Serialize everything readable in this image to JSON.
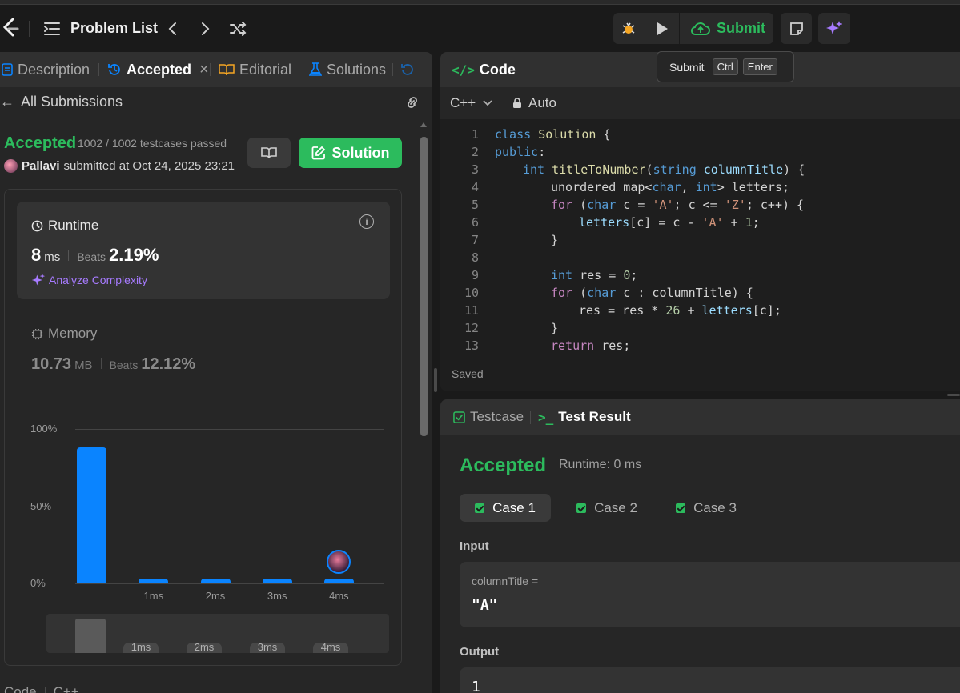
{
  "topbar": {
    "problem_list": "Problem List",
    "submit_label": "Submit"
  },
  "tooltip": {
    "label": "Submit",
    "key1": "Ctrl",
    "key2": "Enter"
  },
  "left_tabs": {
    "description": "Description",
    "accepted": "Accepted",
    "editorial": "Editorial",
    "solutions": "Solutions"
  },
  "submission": {
    "back_label": "All Submissions",
    "status": "Accepted",
    "testcases": "1002 / 1002 testcases passed",
    "user": "Pallavi",
    "submitted_text": "submitted at Oct 24, 2025 23:21",
    "solution_button": "Solution"
  },
  "runtime": {
    "title": "Runtime",
    "value": "8",
    "unit": "ms",
    "beats_label": "Beats",
    "beats_value": "2.19%",
    "analyze": "Analyze Complexity"
  },
  "memory": {
    "title": "Memory",
    "value": "10.73",
    "unit": "MB",
    "beats_label": "Beats",
    "beats_value": "12.12%"
  },
  "chart_data": {
    "type": "bar",
    "categories": [
      "",
      "1ms",
      "2ms",
      "3ms",
      "4ms"
    ],
    "values": [
      88,
      2,
      2,
      2,
      2
    ],
    "ylim": [
      0,
      100
    ],
    "y_ticks": [
      "100%",
      "50%",
      "0%"
    ],
    "minimap_ticks": [
      "1ms",
      "2ms",
      "3ms",
      "4ms"
    ],
    "bar_color": "#0a84ff"
  },
  "bottom_tabs": {
    "code": "Code",
    "lang": "C++"
  },
  "code_panel": {
    "title": "Code",
    "language": "C++",
    "mode": "Auto",
    "saved": "Saved",
    "lines": [
      {
        "n": "1"
      },
      {
        "n": "2"
      },
      {
        "n": "3"
      },
      {
        "n": "4"
      },
      {
        "n": "5"
      },
      {
        "n": "6"
      },
      {
        "n": "7"
      },
      {
        "n": "8"
      },
      {
        "n": "9"
      },
      {
        "n": "10"
      },
      {
        "n": "11"
      },
      {
        "n": "12"
      },
      {
        "n": "13"
      }
    ],
    "tokens": {
      "l1": [
        "class",
        "Solution",
        "{"
      ],
      "l2": [
        "public",
        ":"
      ],
      "l3": [
        "int",
        "titleToNumber",
        "(",
        "string",
        "columnTitle",
        ") {"
      ],
      "l4": [
        "unordered_map<",
        "char",
        ", ",
        "int",
        "> letters;"
      ],
      "l5": [
        "for",
        " (",
        "char",
        " c = ",
        "'A'",
        "; c <= ",
        "'Z'",
        "; c++) {"
      ],
      "l6": [
        "letters",
        "[c] = c - ",
        "'A'",
        " + ",
        "1",
        ";"
      ],
      "l7": [
        "}"
      ],
      "l9": [
        "int",
        " res = ",
        "0",
        ";"
      ],
      "l10": [
        "for",
        " (",
        "char",
        " c : columnTitle) {"
      ],
      "l11": [
        "res = res * ",
        "26",
        " + ",
        "letters",
        "[c];"
      ],
      "l12": [
        "}"
      ],
      "l13": [
        "return",
        " res;"
      ]
    }
  },
  "test_panel": {
    "tab_testcase": "Testcase",
    "tab_result": "Test Result",
    "status": "Accepted",
    "runtime": "Runtime: 0 ms",
    "cases": [
      "Case 1",
      "Case 2",
      "Case 3"
    ],
    "input_label": "Input",
    "input_var": "columnTitle =",
    "input_value": "\"A\"",
    "output_label": "Output",
    "output_value": "1"
  },
  "colors": {
    "accent_green": "#2cbb5d",
    "accent_blue": "#0a84ff",
    "ai_purple": "#a77bff"
  }
}
